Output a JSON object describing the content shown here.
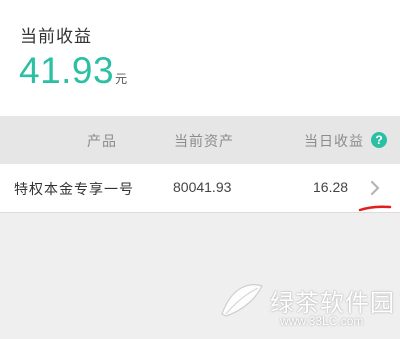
{
  "earnings": {
    "label": "当前收益",
    "amount": "41.93",
    "unit": "元"
  },
  "table": {
    "headers": {
      "product": "产品",
      "asset": "当前资产",
      "daily": "当日收益"
    },
    "help_icon": "question-mark-icon",
    "help_symbol": "?",
    "rows": [
      {
        "product": "特权本金专享一号",
        "asset": "80041.93",
        "daily": "16.28"
      }
    ]
  },
  "watermark": {
    "text": "绿茶软件园",
    "url": "www.33LC.com"
  },
  "colors": {
    "accent": "#2bbfa4",
    "header_bg": "#e6e6e6",
    "annotation": "#e02020"
  }
}
